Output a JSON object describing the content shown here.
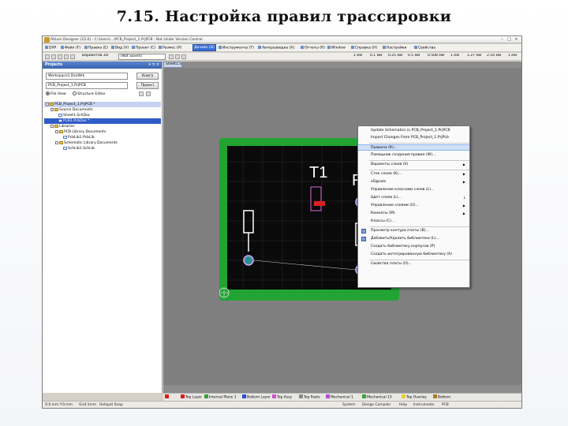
{
  "slide_title": "7.15. Настройка правил трассировки",
  "window": {
    "title": "Altium Designer (15.0) - C:\\Users\\...\\PCB_Project_1.PrjPCB - Not Under Version Control"
  },
  "menubar": {
    "items": [
      "DXP",
      "Файл (F)",
      "Правка (E)",
      "Вид (V)",
      "Проект (C)",
      "Размес (P)",
      "Дизайн (D)",
      "Инструменты (T)",
      "Авторазводка (A)",
      "Отчеты (R)",
      "Window",
      "Справка (H)",
      "Настройки",
      "Свойства"
    ]
  },
  "toolbar": {
    "variant_label": "Вариантов 3D",
    "saved_select": "[Not Saved]",
    "units": [
      "1 мм",
      "0.1 мм",
      "0.25 мм",
      "0.5 мм",
      "0.508 мм",
      "1 мм",
      "1.27 мм",
      "2.54 мм",
      "1 мм"
    ]
  },
  "panel": {
    "title": "Projects",
    "workspace_select": "Workspace1.DsnWrk",
    "workspace_button": "Книга",
    "project_select": "PCB_Project_1.PrjPCB",
    "project_button": "Проект",
    "view_file": "File View",
    "view_structure": "Structure Editor",
    "tree": [
      "PCB_Project_1.PrjPCB *",
      "Source Documents",
      "Sheet1.SchDoc",
      "PCB1.PcbDoc *",
      "Libraries",
      "PCB Library Documents",
      "PcbLib1.PcbLib",
      "Schematic Library Documents",
      "SchLib1.SchLib"
    ]
  },
  "workspace": {
    "doc_tab": "Sheet1.Sc..."
  },
  "dropdown": {
    "items": [
      "Update Schematics in PCB_Project_1.PrjPCB",
      "Import Changes From PCB_Project_1.PrjPcb",
      "Правила (R)...",
      "Помощник создания правил (W)...",
      "Варианты слоев (S)",
      "Стек слоев (K)...",
      "xSignals",
      "Управление классами слоев (L)...",
      "Цвет слоев (L)...",
      "Управление слоями (O)...",
      "Комнаты (M)",
      "Классы (C)...",
      "Просмотр контура платы (B)...",
      "Добавить/Удалить библиотеки (L)...",
      "Создать библиотеку корпусов (P)",
      "Создать интегрированную библиотеку (A)",
      "Свойства платы (O)..."
    ]
  },
  "pcb": {
    "designator_t1": "T1",
    "designator_r1": "R1"
  },
  "layers": [
    "Top Layer",
    "Internal Plane 1",
    "Bottom Layer",
    "Top Assy",
    "Top Paste",
    "Mechanical 1",
    "Mechanical 13",
    "Top Overlay",
    "Bottom"
  ],
  "statusbar": {
    "coords": "X:0.mm Y:0.mm",
    "grid": "Grid:1mm",
    "snap": "Hotspot Snap",
    "panels": [
      "System",
      "Design Compiler",
      "Help",
      "Instruments",
      "PCB"
    ]
  },
  "colors": {
    "accent": "#3b6fd6",
    "board": "#22a334",
    "pcb_bg": "#0a0a0a"
  }
}
